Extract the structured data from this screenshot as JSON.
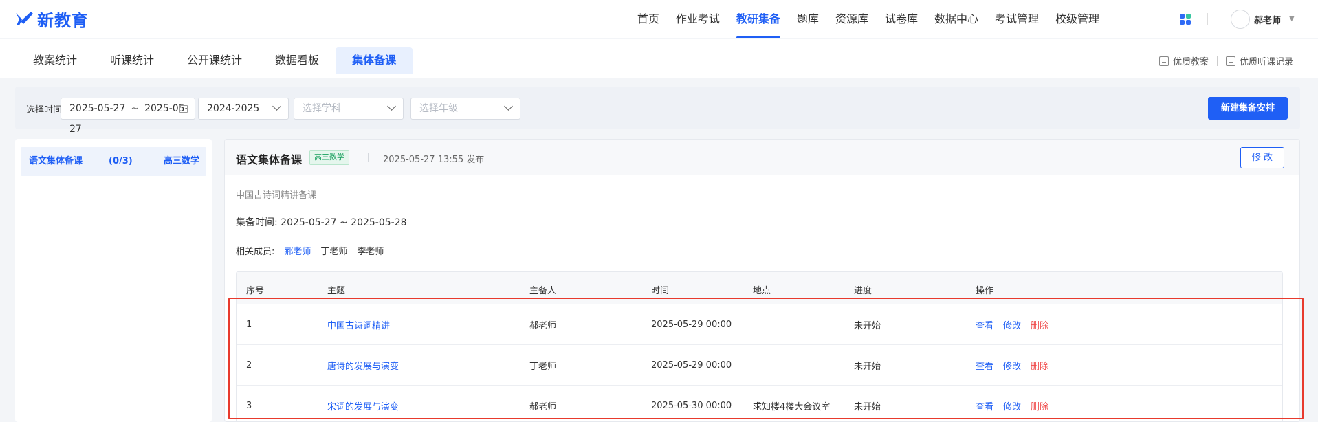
{
  "brand": {
    "name": "新教育",
    "accent": "#1f5ff5"
  },
  "nav": {
    "items": [
      "首页",
      "作业考试",
      "教研集备",
      "题库",
      "资源库",
      "试卷库",
      "数据中心",
      "考试管理",
      "校级管理"
    ],
    "active_index": 2
  },
  "user": {
    "name": "郝老师"
  },
  "subtabs": {
    "items": [
      "教案统计",
      "听课统计",
      "公开课统计",
      "数据看板",
      "集体备课"
    ],
    "active_index": 4
  },
  "quick_links": [
    "优质教案",
    "优质听课记录"
  ],
  "filters": {
    "label": "选择时间:",
    "date_start": "2025-05-27",
    "date_sep": "~",
    "date_end": "2025-05-27",
    "year": "2024-2025",
    "subject_placeholder": "选择学科",
    "grade_placeholder": "选择年级",
    "create_button": "新建集备安排"
  },
  "left_list": [
    {
      "name": "语文集体备课",
      "count": "(0/3)",
      "grade": "高三数学"
    }
  ],
  "detail": {
    "title": "语文集体备课",
    "tag": "高三数学",
    "published": "2025-05-27 13:55 发布",
    "edit_button": "修 改",
    "description": "中国古诗词精讲备课",
    "time_label": "集备时间:",
    "time_range": "2025-05-27 ~ 2025-05-28",
    "members_label": "相关成员:",
    "members": [
      "郝老师",
      "丁老师",
      "李老师"
    ]
  },
  "table": {
    "headers": [
      "序号",
      "主题",
      "主备人",
      "时间",
      "地点",
      "进度",
      "操作"
    ],
    "rows": [
      {
        "no": "1",
        "topic": "中国古诗词精讲",
        "owner": "郝老师",
        "time": "2025-05-29 00:00",
        "place": "",
        "status": "未开始"
      },
      {
        "no": "2",
        "topic": "唐诗的发展与演变",
        "owner": "丁老师",
        "time": "2025-05-29 00:00",
        "place": "",
        "status": "未开始"
      },
      {
        "no": "3",
        "topic": "宋词的发展与演变",
        "owner": "郝老师",
        "time": "2025-05-30 00:00",
        "place": "求知楼4楼大会议室",
        "status": "未开始"
      }
    ],
    "actions": {
      "view": "查看",
      "edit": "修改",
      "delete": "删除"
    }
  },
  "colors": {
    "primary": "#1f5ff5",
    "danger": "#f04b4b",
    "tag_green": "#17a05d",
    "highlight": "#e83a2d"
  }
}
